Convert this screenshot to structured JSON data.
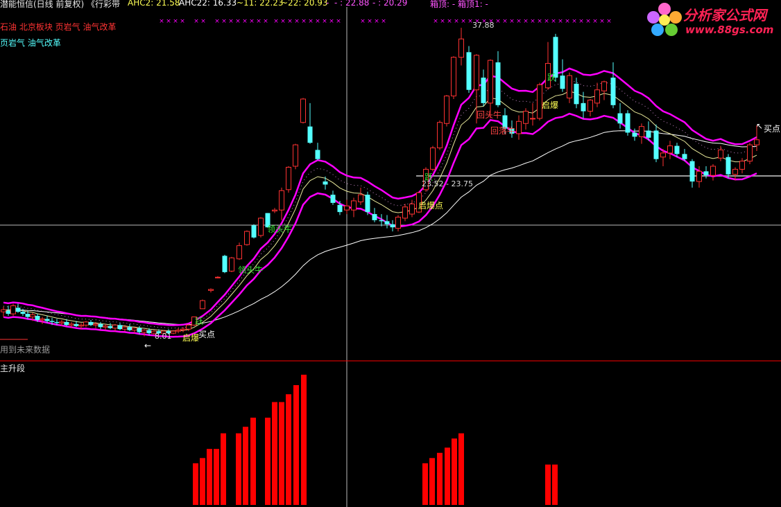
{
  "header": {
    "stock_info": "潜能恒信(日线 前复权) 《行彩带",
    "ahc2_label": "AHC2: 21.58",
    "ahc22_label": "AHC22: 16.33",
    "p11_label": "~11: 22.23",
    "p22_label": "~22: 20.93",
    "dash1": "- ",
    "dash2": "- : 22.88",
    "dash3": "- : 20.29",
    "box_label": "箱顶: -  箱顶1: -"
  },
  "concepts": {
    "line1": "石油 北京板块 页岩气 油气改革",
    "line2": "页岩气 油气改革"
  },
  "logo": {
    "name": "分析家公式网",
    "url": "www.88gs.com"
  },
  "colors": {
    "up": "#ff3232",
    "down": "#54ffff",
    "upper_band": "#ff00ff",
    "lower_band": "#ff00ff",
    "mid_line": "#e8e89a",
    "long_ma": "#ffffff",
    "green_line": "#22dd22",
    "bar": "#ff0000",
    "marker": "#ff00ff",
    "panel_separator": "#ff0000",
    "label_green": "#33dd33",
    "label_yellow": "#ffff44",
    "label_red": "#ff4444"
  },
  "main_panel": {
    "note": "用到未来数据",
    "annotations": {
      "high_price": "37.88",
      "range_label": "23.52 - 23.75",
      "low_price": "8.01",
      "buy_signal_1": "买点",
      "buy_signal_2": "买点",
      "qi_bao_1": "启爆",
      "qi_bao_2": "启爆点",
      "qi_bao_3": "启爆",
      "long_tou_1": "领头牛",
      "long_tou_2": "领头牛",
      "yue_1": "跃",
      "yue_2": "跃",
      "yue_3": "跃",
      "hui_luo": "回头牛",
      "xia_die": "回落牛"
    }
  },
  "sub_panel": {
    "title": "主升段"
  },
  "chart_data": {
    "type": "candlestick",
    "y_range": [
      6,
      40
    ],
    "candles": [
      {
        "x": 5,
        "o": 10.0,
        "h": 10.5,
        "l": 9.5,
        "c": 10.2
      },
      {
        "x": 12,
        "o": 10.1,
        "h": 10.6,
        "l": 9.6,
        "c": 9.8
      },
      {
        "x": 19,
        "o": 9.8,
        "h": 10.8,
        "l": 9.6,
        "c": 10.6
      },
      {
        "x": 26,
        "o": 10.4,
        "h": 10.8,
        "l": 9.9,
        "c": 10.0
      },
      {
        "x": 33,
        "o": 10.0,
        "h": 10.3,
        "l": 9.6,
        "c": 9.8
      },
      {
        "x": 40,
        "o": 9.8,
        "h": 10.1,
        "l": 9.3,
        "c": 9.5
      },
      {
        "x": 47,
        "o": 9.5,
        "h": 9.9,
        "l": 9.1,
        "c": 9.7
      },
      {
        "x": 54,
        "o": 9.6,
        "h": 9.8,
        "l": 9.0,
        "c": 9.2
      },
      {
        "x": 61,
        "o": 9.2,
        "h": 9.5,
        "l": 8.8,
        "c": 9.3
      },
      {
        "x": 68,
        "o": 9.3,
        "h": 9.6,
        "l": 8.9,
        "c": 9.1
      },
      {
        "x": 75,
        "o": 9.1,
        "h": 9.4,
        "l": 8.7,
        "c": 9.0
      },
      {
        "x": 82,
        "o": 9.0,
        "h": 9.3,
        "l": 8.7,
        "c": 8.9
      },
      {
        "x": 89,
        "o": 8.9,
        "h": 9.2,
        "l": 8.6,
        "c": 9.0
      },
      {
        "x": 96,
        "o": 9.0,
        "h": 9.3,
        "l": 8.6,
        "c": 8.7
      },
      {
        "x": 103,
        "o": 8.7,
        "h": 9.0,
        "l": 8.4,
        "c": 8.8
      },
      {
        "x": 110,
        "o": 8.8,
        "h": 9.1,
        "l": 8.5,
        "c": 8.6
      },
      {
        "x": 117,
        "o": 8.6,
        "h": 8.9,
        "l": 8.3,
        "c": 8.7
      },
      {
        "x": 124,
        "o": 8.7,
        "h": 9.1,
        "l": 8.5,
        "c": 9.0
      },
      {
        "x": 131,
        "o": 9.0,
        "h": 9.2,
        "l": 8.6,
        "c": 8.7
      },
      {
        "x": 138,
        "o": 8.7,
        "h": 9.0,
        "l": 8.4,
        "c": 8.8
      },
      {
        "x": 145,
        "o": 8.8,
        "h": 9.0,
        "l": 8.3,
        "c": 8.5
      },
      {
        "x": 152,
        "o": 8.5,
        "h": 8.8,
        "l": 8.2,
        "c": 8.6
      },
      {
        "x": 159,
        "o": 8.6,
        "h": 8.9,
        "l": 8.3,
        "c": 8.4
      },
      {
        "x": 166,
        "o": 8.4,
        "h": 8.8,
        "l": 8.1,
        "c": 8.7
      },
      {
        "x": 173,
        "o": 8.7,
        "h": 8.9,
        "l": 8.2,
        "c": 8.3
      },
      {
        "x": 180,
        "o": 8.3,
        "h": 8.7,
        "l": 8.1,
        "c": 8.5
      },
      {
        "x": 187,
        "o": 8.5,
        "h": 8.8,
        "l": 8.1,
        "c": 8.2
      },
      {
        "x": 194,
        "o": 8.2,
        "h": 8.5,
        "l": 7.9,
        "c": 8.4
      },
      {
        "x": 201,
        "o": 8.4,
        "h": 8.6,
        "l": 7.8,
        "c": 8.0
      },
      {
        "x": 208,
        "o": 8.0,
        "h": 8.3,
        "l": 7.6,
        "c": 8.2
      },
      {
        "x": 215,
        "o": 8.2,
        "h": 8.4,
        "l": 7.7,
        "c": 7.9
      },
      {
        "x": 222,
        "o": 7.9,
        "h": 8.2,
        "l": 7.7,
        "c": 8.1
      },
      {
        "x": 229,
        "o": 8.1,
        "h": 8.3,
        "l": 7.8,
        "c": 7.9
      },
      {
        "x": 236,
        "o": 7.9,
        "h": 8.2,
        "l": 7.8,
        "c": 8.1
      },
      {
        "x": 243,
        "o": 8.1,
        "h": 8.3,
        "l": 7.8,
        "c": 7.9
      },
      {
        "x": 250,
        "o": 7.9,
        "h": 8.2,
        "l": 7.8,
        "c": 8.1
      },
      {
        "x": 257,
        "o": 8.1,
        "h": 8.4,
        "l": 7.9,
        "c": 8.2
      },
      {
        "x": 264,
        "o": 8.2,
        "h": 8.5,
        "l": 8.0,
        "c": 8.3
      },
      {
        "x": 272,
        "o": 8.3,
        "h": 8.8,
        "l": 8.1,
        "c": 8.7
      },
      {
        "x": 280,
        "o": 8.7,
        "h": 9.5,
        "l": 8.6,
        "c": 9.5
      },
      {
        "x": 292,
        "o": 10.3,
        "h": 11.2,
        "l": 10.3,
        "c": 11.1
      },
      {
        "x": 304,
        "o": 12.1,
        "h": 12.3,
        "l": 11.9,
        "c": 12.2
      },
      {
        "x": 314,
        "o": 13.4,
        "h": 13.5,
        "l": 13.3,
        "c": 13.4
      },
      {
        "x": 324,
        "o": 15.5,
        "h": 15.6,
        "l": 13.8,
        "c": 13.9
      },
      {
        "x": 334,
        "o": 14.0,
        "h": 15.4,
        "l": 13.9,
        "c": 15.3
      },
      {
        "x": 345,
        "o": 15.2,
        "h": 16.8,
        "l": 15.1,
        "c": 16.5
      },
      {
        "x": 356,
        "o": 16.6,
        "h": 18.0,
        "l": 16.5,
        "c": 17.9
      },
      {
        "x": 366,
        "o": 18.5,
        "h": 18.6,
        "l": 17.2,
        "c": 17.3
      },
      {
        "x": 376,
        "o": 17.5,
        "h": 19.3,
        "l": 17.3,
        "c": 19.2
      },
      {
        "x": 386,
        "o": 19.7,
        "h": 19.7,
        "l": 18.3,
        "c": 18.3
      },
      {
        "x": 396,
        "o": 19.9,
        "h": 20.2,
        "l": 19.7,
        "c": 20.0
      },
      {
        "x": 406,
        "o": 20.0,
        "h": 22.2,
        "l": 19.0,
        "c": 21.9
      },
      {
        "x": 416,
        "o": 22.0,
        "h": 24.3,
        "l": 21.7,
        "c": 24.2
      },
      {
        "x": 426,
        "o": 24.3,
        "h": 26.5,
        "l": 24.0,
        "c": 26.4
      },
      {
        "x": 437,
        "o": 28.6,
        "h": 31.0,
        "l": 28.5,
        "c": 30.9
      },
      {
        "x": 447,
        "o": 28.2,
        "h": 30.5,
        "l": 26.5,
        "c": 26.6
      },
      {
        "x": 458,
        "o": 25.9,
        "h": 26.6,
        "l": 24.9,
        "c": 25.0
      },
      {
        "x": 469,
        "o": 22.8,
        "h": 23.3,
        "l": 22.0,
        "c": 22.5
      },
      {
        "x": 480,
        "o": 21.5,
        "h": 21.9,
        "l": 20.5,
        "c": 20.7
      },
      {
        "x": 490,
        "o": 20.5,
        "h": 20.9,
        "l": 19.5,
        "c": 19.8
      },
      {
        "x": 500,
        "o": 20.0,
        "h": 21.0,
        "l": 19.6,
        "c": 20.4
      },
      {
        "x": 510,
        "o": 20.0,
        "h": 21.2,
        "l": 19.3,
        "c": 20.9
      },
      {
        "x": 520,
        "o": 20.8,
        "h": 22.2,
        "l": 20.5,
        "c": 21.5
      },
      {
        "x": 530,
        "o": 21.5,
        "h": 21.8,
        "l": 19.5,
        "c": 19.8
      },
      {
        "x": 540,
        "o": 19.6,
        "h": 20.2,
        "l": 18.8,
        "c": 19.0
      },
      {
        "x": 550,
        "o": 19.0,
        "h": 19.6,
        "l": 18.4,
        "c": 18.9
      },
      {
        "x": 558,
        "o": 18.9,
        "h": 19.5,
        "l": 18.2,
        "c": 18.6
      },
      {
        "x": 566,
        "o": 18.6,
        "h": 19.0,
        "l": 17.9,
        "c": 18.3
      },
      {
        "x": 574,
        "o": 18.2,
        "h": 19.5,
        "l": 17.9,
        "c": 19.3
      },
      {
        "x": 584,
        "o": 19.2,
        "h": 20.6,
        "l": 18.9,
        "c": 20.3
      },
      {
        "x": 594,
        "o": 19.6,
        "h": 21.0,
        "l": 19.3,
        "c": 20.6
      },
      {
        "x": 604,
        "o": 19.8,
        "h": 21.8,
        "l": 19.7,
        "c": 21.7
      },
      {
        "x": 614,
        "o": 22.0,
        "h": 24.2,
        "l": 21.8,
        "c": 24.0
      },
      {
        "x": 624,
        "o": 24.0,
        "h": 26.3,
        "l": 23.8,
        "c": 26.1
      },
      {
        "x": 634,
        "o": 26.1,
        "h": 28.8,
        "l": 25.9,
        "c": 28.6
      },
      {
        "x": 644,
        "o": 28.5,
        "h": 31.3,
        "l": 28.2,
        "c": 31.2
      },
      {
        "x": 654,
        "o": 31.2,
        "h": 35.1,
        "l": 30.9,
        "c": 35.0
      },
      {
        "x": 665,
        "o": 35.0,
        "h": 37.9,
        "l": 34.2,
        "c": 36.8
      },
      {
        "x": 676,
        "o": 35.5,
        "h": 36.1,
        "l": 31.5,
        "c": 31.8
      },
      {
        "x": 687,
        "o": 31.8,
        "h": 35.3,
        "l": 28.5,
        "c": 35.2
      },
      {
        "x": 697,
        "o": 33.0,
        "h": 33.8,
        "l": 30.2,
        "c": 30.5
      },
      {
        "x": 707,
        "o": 30.5,
        "h": 34.8,
        "l": 29.0,
        "c": 34.7
      },
      {
        "x": 718,
        "o": 34.5,
        "h": 35.6,
        "l": 30.1,
        "c": 30.3
      },
      {
        "x": 728,
        "o": 29.3,
        "h": 30.0,
        "l": 27.5,
        "c": 28.0
      },
      {
        "x": 738,
        "o": 28.0,
        "h": 28.8,
        "l": 27.1,
        "c": 27.5
      },
      {
        "x": 748,
        "o": 27.5,
        "h": 29.3,
        "l": 26.9,
        "c": 28.7
      },
      {
        "x": 758,
        "o": 28.5,
        "h": 30.0,
        "l": 27.9,
        "c": 29.7
      },
      {
        "x": 768,
        "o": 29.0,
        "h": 30.5,
        "l": 28.3,
        "c": 29.0
      },
      {
        "x": 778,
        "o": 29.0,
        "h": 32.5,
        "l": 28.8,
        "c": 32.3
      },
      {
        "x": 790,
        "o": 32.0,
        "h": 36.5,
        "l": 31.8,
        "c": 34.4
      },
      {
        "x": 801,
        "o": 37.0,
        "h": 37.3,
        "l": 32.6,
        "c": 33.0
      },
      {
        "x": 811,
        "o": 33.2,
        "h": 34.8,
        "l": 31.6,
        "c": 31.9
      },
      {
        "x": 821,
        "o": 31.0,
        "h": 33.5,
        "l": 30.5,
        "c": 33.2
      },
      {
        "x": 831,
        "o": 32.4,
        "h": 33.0,
        "l": 30.0,
        "c": 30.4
      },
      {
        "x": 841,
        "o": 30.5,
        "h": 31.6,
        "l": 29.0,
        "c": 29.7
      },
      {
        "x": 851,
        "o": 29.7,
        "h": 30.9,
        "l": 29.2,
        "c": 30.8
      },
      {
        "x": 861,
        "o": 30.5,
        "h": 32.5,
        "l": 30.1,
        "c": 31.8
      },
      {
        "x": 871,
        "o": 31.7,
        "h": 32.7,
        "l": 30.8,
        "c": 32.6
      },
      {
        "x": 884,
        "o": 33.0,
        "h": 34.5,
        "l": 30.0,
        "c": 30.3
      },
      {
        "x": 894,
        "o": 29.5,
        "h": 30.5,
        "l": 28.0,
        "c": 28.5
      },
      {
        "x": 905,
        "o": 29.5,
        "h": 29.8,
        "l": 27.3,
        "c": 27.6
      },
      {
        "x": 915,
        "o": 27.6,
        "h": 28.0,
        "l": 26.8,
        "c": 27.2
      },
      {
        "x": 925,
        "o": 27.2,
        "h": 28.5,
        "l": 26.5,
        "c": 28.2
      },
      {
        "x": 935,
        "o": 27.8,
        "h": 28.7,
        "l": 26.8,
        "c": 27.1
      },
      {
        "x": 946,
        "o": 27.8,
        "h": 28.4,
        "l": 24.7,
        "c": 25.0
      },
      {
        "x": 956,
        "o": 25.2,
        "h": 26.0,
        "l": 24.3,
        "c": 25.6
      },
      {
        "x": 966,
        "o": 25.6,
        "h": 26.8,
        "l": 25.0,
        "c": 26.3
      },
      {
        "x": 976,
        "o": 26.3,
        "h": 26.6,
        "l": 25.2,
        "c": 25.5
      },
      {
        "x": 987,
        "o": 25.5,
        "h": 26.0,
        "l": 24.8,
        "c": 25.0
      },
      {
        "x": 998,
        "o": 24.8,
        "h": 25.0,
        "l": 22.2,
        "c": 22.8
      },
      {
        "x": 1008,
        "o": 22.8,
        "h": 24.3,
        "l": 22.2,
        "c": 23.8
      },
      {
        "x": 1018,
        "o": 23.8,
        "h": 24.3,
        "l": 23.1,
        "c": 23.4
      },
      {
        "x": 1028,
        "o": 23.4,
        "h": 24.5,
        "l": 22.9,
        "c": 24.3
      },
      {
        "x": 1039,
        "o": 25.1,
        "h": 26.3,
        "l": 24.8,
        "c": 25.9
      },
      {
        "x": 1050,
        "o": 25.2,
        "h": 25.5,
        "l": 23.1,
        "c": 23.5
      },
      {
        "x": 1060,
        "o": 23.5,
        "h": 24.2,
        "l": 22.9,
        "c": 24.0
      },
      {
        "x": 1070,
        "o": 24.0,
        "h": 25.1,
        "l": 23.6,
        "c": 24.8
      },
      {
        "x": 1081,
        "o": 24.8,
        "h": 26.6,
        "l": 24.5,
        "c": 26.4
      },
      {
        "x": 1091,
        "o": 26.4,
        "h": 28.3,
        "l": 25.8,
        "c": 26.9
      }
    ],
    "sub_bars": [
      {
        "x": 282,
        "v": 0.32
      },
      {
        "x": 292,
        "v": 0.36
      },
      {
        "x": 302,
        "v": 0.43
      },
      {
        "x": 312,
        "v": 0.43
      },
      {
        "x": 322,
        "v": 0.55
      },
      {
        "x": 344,
        "v": 0.55
      },
      {
        "x": 354,
        "v": 0.6
      },
      {
        "x": 365,
        "v": 0.67
      },
      {
        "x": 386,
        "v": 0.67
      },
      {
        "x": 396,
        "v": 0.79
      },
      {
        "x": 406,
        "v": 0.79
      },
      {
        "x": 416,
        "v": 0.85
      },
      {
        "x": 427,
        "v": 0.92
      },
      {
        "x": 438,
        "v": 1.0
      },
      {
        "x": 613,
        "v": 0.32
      },
      {
        "x": 623,
        "v": 0.36
      },
      {
        "x": 634,
        "v": 0.4
      },
      {
        "x": 645,
        "v": 0.44
      },
      {
        "x": 655,
        "v": 0.51
      },
      {
        "x": 665,
        "v": 0.55
      },
      {
        "x": 790,
        "v": 0.31
      },
      {
        "x": 800,
        "v": 0.31
      }
    ]
  }
}
